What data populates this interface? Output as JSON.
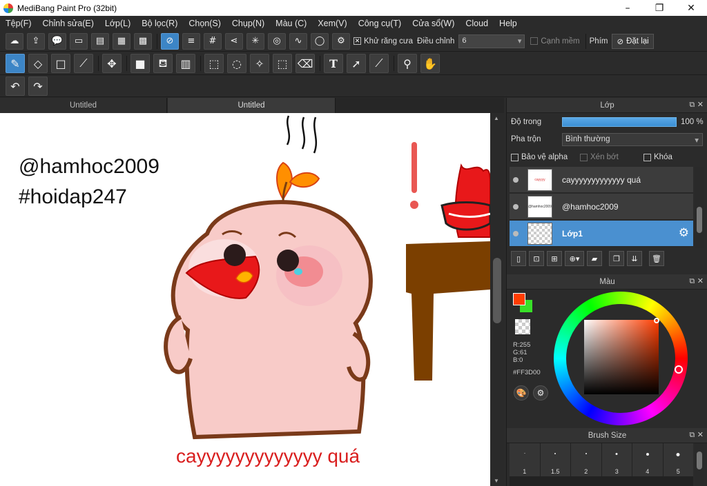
{
  "window": {
    "title": "MediBang Paint Pro (32bit)",
    "controls": {
      "minimize": "–",
      "maximize": "❐",
      "close": "✕"
    }
  },
  "menu": [
    "Tệp(F)",
    "Chỉnh sửa(E)",
    "Lớp(L)",
    "Bộ lọc(R)",
    "Chọn(S)",
    "Chụp(N)",
    "Màu (C)",
    "Xem(V)",
    "Công cụ(T)",
    "Cửa sổ(W)",
    "Cloud",
    "Help"
  ],
  "toolbar1": {
    "antialias_label": "Khử răng cưa",
    "antialias_checked": true,
    "correction_label": "Điều chỉnh",
    "correction_value": "6",
    "soft_edge_label": "Cạnh mềm",
    "key_label": "Phím",
    "reset_label": "Đặt lại"
  },
  "doc_tabs": [
    "Untitled",
    "Untitled"
  ],
  "canvas": {
    "text_line1": "@hamhoc2009",
    "text_line2": "#hoidap247",
    "caption": "cayyyyyyyyyyyyy quá",
    "exclaim": "!"
  },
  "layers_panel": {
    "title": "Lớp",
    "opacity_label": "Độ trong",
    "opacity_value": "100 %",
    "opacity_percent": 100,
    "blend_label": "Pha trộn",
    "blend_value": "Bình thường",
    "protect_alpha_label": "Bảo vệ alpha",
    "clipping_label": "Xén bớt",
    "lock_label": "Khóa",
    "layers": [
      {
        "name": "cayyyyyyyyyyyyy quá",
        "thumb": "cayyyy",
        "active": false
      },
      {
        "name": "@hamhoc2009",
        "thumb": "@hamhoc2009",
        "active": false
      },
      {
        "name": "Lớp1",
        "thumb": "",
        "active": true
      }
    ]
  },
  "color_panel": {
    "title": "Màu",
    "r": "R:255",
    "g": "G:61",
    "b": "B:0",
    "hex": "#FF3D00",
    "colors": {
      "foreground": "#FF3D00",
      "background": "#38E028",
      "accent": "#4A90D0"
    }
  },
  "brush_panel": {
    "title": "Brush Size",
    "sizes": [
      "1",
      "1.5",
      "2",
      "3",
      "4",
      "5"
    ]
  }
}
